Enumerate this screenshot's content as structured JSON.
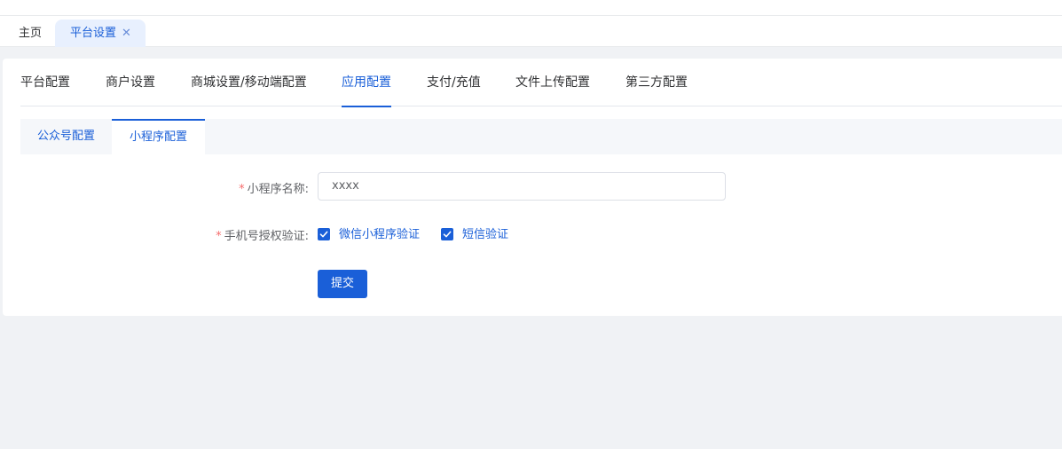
{
  "tags": {
    "home": "主页",
    "active": "平台设置",
    "close_glyph": "✕"
  },
  "tabs": [
    {
      "label": "平台配置"
    },
    {
      "label": "商户设置"
    },
    {
      "label": "商城设置/移动端配置"
    },
    {
      "label": "应用配置",
      "active": true
    },
    {
      "label": "支付/充值"
    },
    {
      "label": "文件上传配置"
    },
    {
      "label": "第三方配置"
    }
  ],
  "subtabs": [
    {
      "label": "公众号配置"
    },
    {
      "label": "小程序配置",
      "active": true
    }
  ],
  "form": {
    "required_mark": "*",
    "name_label": "小程序名称:",
    "name_value": "xxxx",
    "auth_label": "手机号授权验证:",
    "options": [
      {
        "label": "微信小程序验证",
        "checked": true
      },
      {
        "label": "短信验证",
        "checked": true
      }
    ],
    "submit": "提交"
  },
  "colors": {
    "accent": "#1a5fd8",
    "required": "#f56c6c"
  }
}
